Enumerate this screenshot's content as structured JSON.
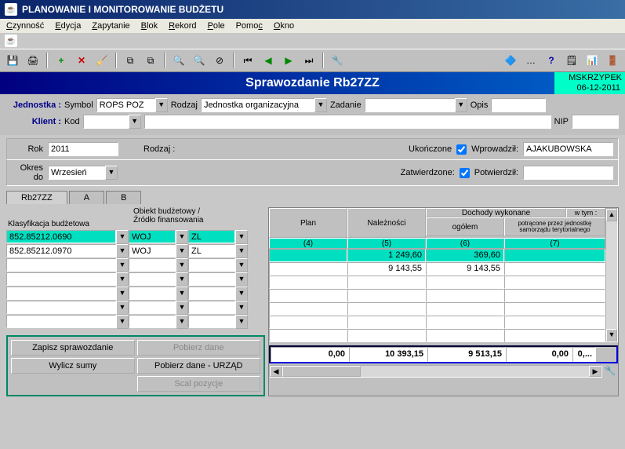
{
  "window": {
    "title": "PLANOWANIE I MONITOROWANIE BUDŻETU"
  },
  "menu": {
    "items": [
      "Czynność",
      "Edycja",
      "Zapytanie",
      "Blok",
      "Rekord",
      "Pole",
      "Pomoc",
      "Okno"
    ]
  },
  "header": {
    "title": "Sprawozdanie Rb27ZZ",
    "user": "MSKRZYPEK",
    "date": "06-12-2011"
  },
  "form": {
    "jednostka_label": "Jednostka :",
    "symbol_label": "Symbol",
    "symbol_value": "ROPS POZ",
    "rodzaj_label": "Rodzaj",
    "rodzaj_value": "Jednostka organizacyjna",
    "zadanie_label": "Zadanie",
    "zadanie_value": "",
    "opis_label": "Opis",
    "opis_value": "",
    "klient_label": "Klient :",
    "kod_label": "Kod",
    "kod_value": "",
    "nip_label": "NIP",
    "nip_value": ""
  },
  "period": {
    "rok_label": "Rok",
    "rok_value": "2011",
    "rodzaj_label": "Rodzaj :",
    "okres_label": "Okres do",
    "okres_value": "Wrzesień",
    "ukonczone_label": "Ukończone",
    "zatwierdzone_label": "Zatwierdzone:",
    "wprowadzil_label": "Wprowadził:",
    "wprowadzil_value": "AJAKUBOWSKA",
    "potwierdzil_label": "Potwierdził:",
    "potwierdzil_value": ""
  },
  "tabs": {
    "t1": "Rb27ZZ",
    "t2": "A",
    "t3": "B"
  },
  "cls": {
    "h1": "Klasyfikacja budżetowa",
    "h2": "Obiekt budżetowy /\nŹródło finansowania",
    "rows": [
      {
        "kod": "852.85212.0690",
        "ob": "WOJ",
        "zr": "ZL",
        "hl": true
      },
      {
        "kod": "852.85212.0970",
        "ob": "WOJ",
        "zr": "ZL",
        "hl": false
      }
    ]
  },
  "grid": {
    "headers": {
      "plan": "Plan",
      "nalez": "Należności",
      "dochody": "Dochody wykonane",
      "ogolem": "ogółem",
      "wtym": "w tym :",
      "potracone": "potrącone przez jednostkę samorządu terytorialnego",
      "col4": "(4)",
      "col5": "(5)",
      "col6": "(6)",
      "col7": "(7)"
    },
    "rows": [
      {
        "c4": "",
        "c5": "1 249,60",
        "c6": "369,60",
        "c7": "",
        "hl": true
      },
      {
        "c4": "",
        "c5": "9 143,55",
        "c6": "9 143,55",
        "c7": "",
        "hl": false
      },
      {
        "c4": "",
        "c5": "",
        "c6": "",
        "c7": ""
      },
      {
        "c4": "",
        "c5": "",
        "c6": "",
        "c7": ""
      },
      {
        "c4": "",
        "c5": "",
        "c6": "",
        "c7": ""
      },
      {
        "c4": "",
        "c5": "",
        "c6": "",
        "c7": ""
      },
      {
        "c4": "",
        "c5": "",
        "c6": "",
        "c7": ""
      }
    ],
    "totals": {
      "c4": "0,00",
      "c5": "10 393,15",
      "c6": "9 513,15",
      "c7": "0,00",
      "extra": "0,..."
    }
  },
  "actions": {
    "zapisz": "Zapisz sprawozdanie",
    "pobierz": "Pobierz dane",
    "wylicz": "Wylicz sumy",
    "pobierz_urzad": "Pobierz dane - URZĄD",
    "scal": "Scal pozycje"
  }
}
